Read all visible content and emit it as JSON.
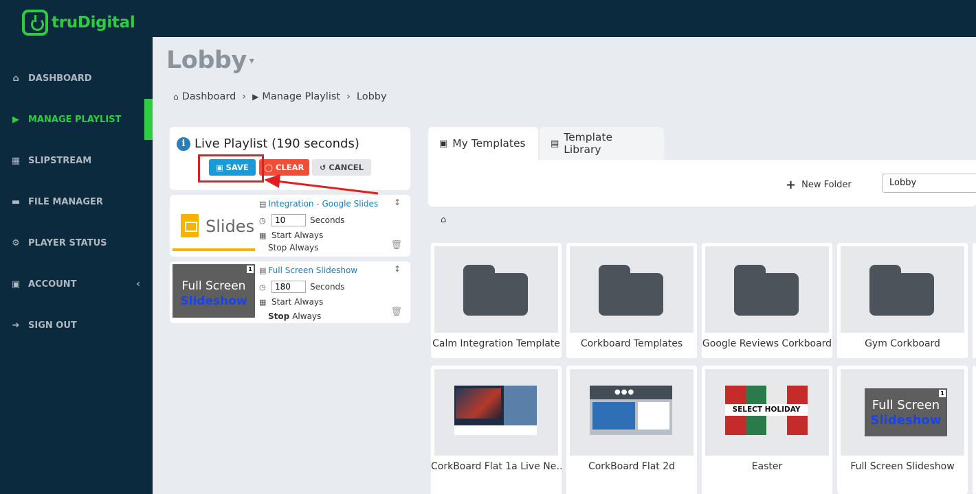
{
  "brand": {
    "name": "truDigital",
    "accent": "#2ecc40"
  },
  "sidebar": {
    "items": [
      {
        "label": "DASHBOARD",
        "icon": "home-icon"
      },
      {
        "label": "MANAGE PLAYLIST",
        "icon": "play-icon",
        "active": true
      },
      {
        "label": "SLIPSTREAM",
        "icon": "sitemap-icon"
      },
      {
        "label": "FILE MANAGER",
        "icon": "folder-icon"
      },
      {
        "label": "PLAYER STATUS",
        "icon": "cogs-icon"
      },
      {
        "label": "ACCOUNT",
        "icon": "briefcase-icon"
      },
      {
        "label": "SIGN OUT",
        "icon": "sign-out-icon"
      }
    ]
  },
  "page": {
    "title": "Lobby"
  },
  "breadcrumb": {
    "home": "Dashboard",
    "section": "Manage Playlist",
    "current": "Lobby"
  },
  "playlist": {
    "title": "Live Playlist (190 seconds)",
    "save_label": "SAVE",
    "clear_label": "CLEAR",
    "cancel_label": "CANCEL",
    "items": [
      {
        "name": "Integration - Google Slides",
        "thumb_text": "Slides",
        "duration": "10",
        "seconds_label": "Seconds",
        "start": "Start Always",
        "stop_word": "Stop",
        "stop_value": "Always"
      },
      {
        "name": "Full Screen Slideshow",
        "thumb_line1": "Full Screen",
        "thumb_line2": "Slideshow",
        "thumb_badge": "1",
        "duration": "180",
        "seconds_label": "Seconds",
        "start": "Start Always",
        "stop_word": "Stop",
        "stop_value": "Always"
      }
    ]
  },
  "tabs": {
    "my_templates": "My Templates",
    "template_library": "Template Library"
  },
  "toolbar": {
    "new_folder": "New Folder",
    "folder_value": "Lobby"
  },
  "grid": {
    "folders": [
      "Calm Integration Template",
      "Corkboard Templates",
      "Google Reviews Corkboard",
      "Gym Corkboard"
    ],
    "templates": [
      {
        "label": "CorkBoard Flat 1a Live Ne…"
      },
      {
        "label": "CorkBoard Flat 2d"
      },
      {
        "label": "Easter",
        "thumb_text": "SELECT HOLIDAY"
      },
      {
        "label": "Full Screen Slideshow",
        "thumb_line1": "Full Screen",
        "thumb_line2": "Slideshow",
        "thumb_badge": "1"
      }
    ]
  }
}
